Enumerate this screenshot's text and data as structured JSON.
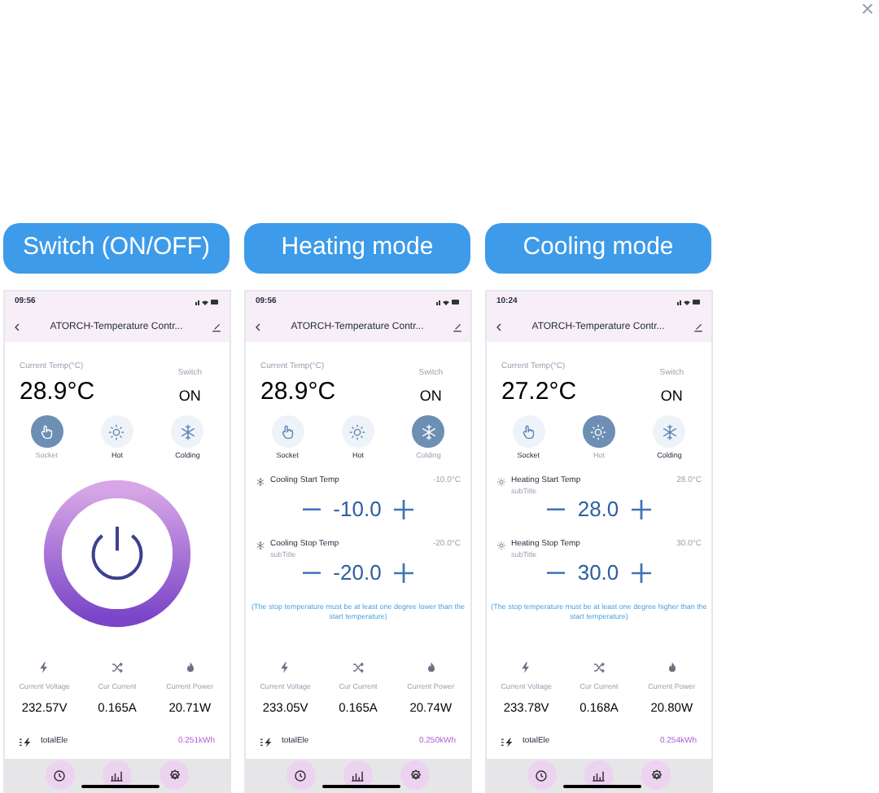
{
  "close": "×",
  "phones": [
    {
      "label": "Switch (ON/OFF)",
      "time": "09:56",
      "title": "ATORCH-Temperature Contr...",
      "temp_label": "Current Temp(°C)",
      "temp": "28.9°C",
      "switch_label": "Switch",
      "switch_value": "ON",
      "modes": [
        {
          "kind": "hand",
          "label": "Socket",
          "selected": true
        },
        {
          "kind": "sun",
          "label": "Hot",
          "selected": false
        },
        {
          "kind": "snowflake",
          "label": "Colding",
          "selected": false
        }
      ],
      "body": {
        "kind": "power"
      },
      "stats": [
        {
          "label": "Current Voltage",
          "value": "232.57V"
        },
        {
          "label": "Cur Current",
          "value": "0.165A"
        },
        {
          "label": "Current Power",
          "value": "20.71W"
        }
      ],
      "total": {
        "label": "totalEle",
        "value": "0.251kWh"
      }
    },
    {
      "label": "Heating mode",
      "time": "09:56",
      "title": "ATORCH-Temperature Contr...",
      "temp_label": "Current Temp(°C)",
      "temp": "28.9°C",
      "switch_label": "Switch",
      "switch_value": "ON",
      "modes": [
        {
          "kind": "hand",
          "label": "Socket",
          "selected": false
        },
        {
          "kind": "sun",
          "label": "Hot",
          "selected": false
        },
        {
          "kind": "snowflake",
          "label": "Colding",
          "selected": true
        }
      ],
      "body": {
        "kind": "setpoints",
        "setpoints": [
          {
            "kind": "snowflake",
            "label": "Cooling Start Temp",
            "reading": "-10.0°C",
            "value": "-10.0"
          },
          {
            "kind": "snowflake",
            "label": "Cooling Stop Temp",
            "subtitle": "subTitle",
            "reading": "-20.0°C",
            "value": "-20.0"
          }
        ],
        "note": "(The stop temperature must be at least one degree lower than the start temperature)"
      },
      "stats": [
        {
          "label": "Current Voltage",
          "value": "233.05V"
        },
        {
          "label": "Cur Current",
          "value": "0.165A"
        },
        {
          "label": "Current Power",
          "value": "20.74W"
        }
      ],
      "total": {
        "label": "totalEle",
        "value": "0.250kWh"
      }
    },
    {
      "label": "Cooling mode",
      "time": "10:24",
      "title": "ATORCH-Temperature Contr...",
      "temp_label": "Current Temp(°C)",
      "temp": "27.2°C",
      "switch_label": "Switch",
      "switch_value": "ON",
      "modes": [
        {
          "kind": "hand",
          "label": "Socket",
          "selected": false
        },
        {
          "kind": "sun",
          "label": "Hot",
          "selected": true
        },
        {
          "kind": "snowflake",
          "label": "Colding",
          "selected": false
        }
      ],
      "body": {
        "kind": "setpoints",
        "setpoints": [
          {
            "kind": "sun",
            "label": "Heating Start Temp",
            "subtitle": "subTitle",
            "reading": "28.0°C",
            "value": "28.0"
          },
          {
            "kind": "sun",
            "label": "Heating Stop Temp",
            "subtitle": "subTitle",
            "reading": "30.0°C",
            "value": "30.0"
          }
        ],
        "note": "(The stop temperature must be at least one degree higher than the start temperature)"
      },
      "stats": [
        {
          "label": "Current Voltage",
          "value": "233.78V"
        },
        {
          "label": "Cur Current",
          "value": "0.168A"
        },
        {
          "label": "Current Power",
          "value": "20.80W"
        }
      ],
      "total": {
        "label": "totalEle",
        "value": "0.254kWh"
      }
    }
  ]
}
